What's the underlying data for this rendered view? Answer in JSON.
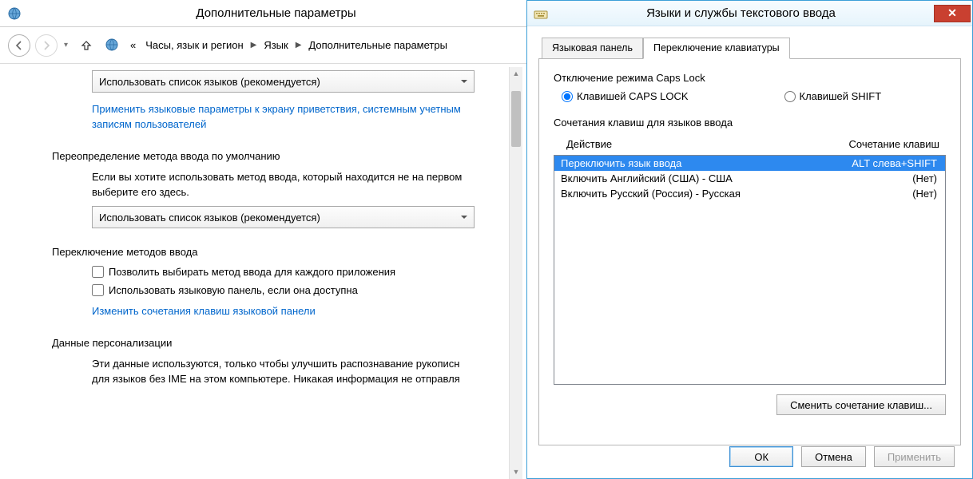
{
  "cp": {
    "title": "Дополнительные параметры",
    "breadcrumb": {
      "dots": "«",
      "items": [
        "Часы, язык и регион",
        "Язык",
        "Дополнительные параметры"
      ]
    },
    "dropdown1": "Использовать список языков (рекомендуется)",
    "link_welcome": "Применить языковые параметры к экрану приветствия, системным учетным записям пользователей",
    "h_override": "Переопределение метода ввода по умолчанию",
    "p_override": "Если вы хотите использовать метод ввода, который находится не на первом выберите его здесь.",
    "dropdown2": "Использовать список языков (рекомендуется)",
    "h_switch": "Переключение методов ввода",
    "cb1": "Позволить выбирать метод ввода для каждого приложения",
    "cb2": "Использовать языковую панель, если она доступна",
    "link_hotkeys": "Изменить сочетания клавиш языковой панели",
    "h_personal": "Данные персонализации",
    "p_personal": "Эти данные используются, только чтобы улучшить распознавание рукописн для языков без IME на этом компьютере. Никакая информация не отправля"
  },
  "dlg": {
    "title": "Языки и службы текстового ввода",
    "tabs": [
      "Языковая панель",
      "Переключение клавиатуры"
    ],
    "caps_label": "Отключение режима Caps Lock",
    "radio_caps": "Клавишей CAPS LOCK",
    "radio_shift": "Клавишей SHIFT",
    "hot_label": "Сочетания клавиш для языков ввода",
    "col_action": "Действие",
    "col_keys": "Сочетание клавиш",
    "rows": [
      {
        "action": "Переключить язык ввода",
        "keys": "ALT слева+SHIFT"
      },
      {
        "action": "Включить Английский (США) - США",
        "keys": "(Нет)"
      },
      {
        "action": "Включить Русский (Россия) - Русская",
        "keys": "(Нет)"
      }
    ],
    "btn_change": "Сменить сочетание клавиш...",
    "btn_ok": "ОК",
    "btn_cancel": "Отмена",
    "btn_apply": "Применить"
  }
}
